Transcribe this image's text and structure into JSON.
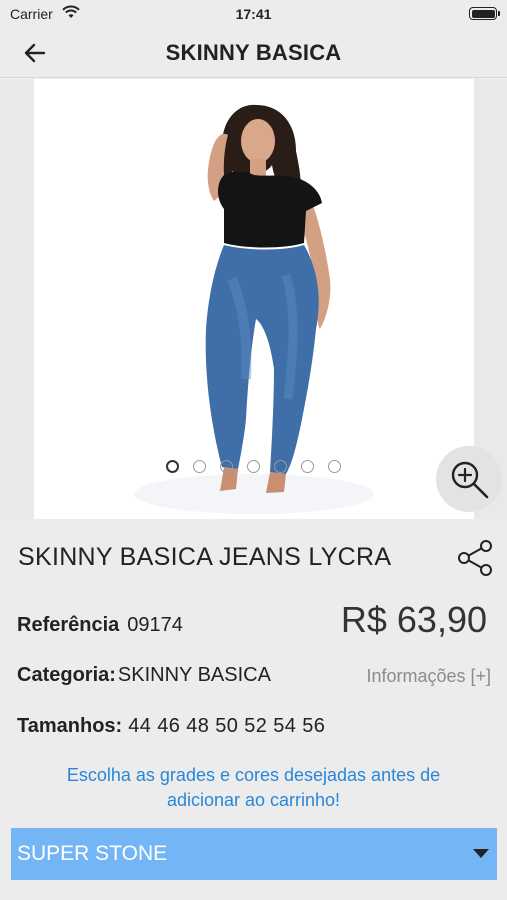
{
  "status_bar": {
    "carrier": "Carrier",
    "time": "17:41"
  },
  "nav": {
    "title": "SKINNY BASICA",
    "back_icon": "arrow-left-icon"
  },
  "gallery": {
    "image_count": 7,
    "active_index": 0,
    "zoom_icon": "zoom-in-icon"
  },
  "product": {
    "name": "SKINNY BASICA JEANS LYCRA",
    "price": "R$ 63,90",
    "reference_label": "Referência",
    "reference_value": "09174",
    "category_label": "Categoria:",
    "category_value": "SKINNY BASICA",
    "info_link": "Informações [+]",
    "sizes_label": "Tamanhos:",
    "sizes_value": "44 46 48 50 52 54 56"
  },
  "notice": {
    "line1": "Escolha as grades e cores desejadas antes de",
    "line2": "adicionar ao carrinho!"
  },
  "color_select": {
    "selected": "SUPER STONE"
  },
  "colors": {
    "accent": "#2a86d8",
    "select_bg": "#74b6f5",
    "background": "#ececec"
  }
}
